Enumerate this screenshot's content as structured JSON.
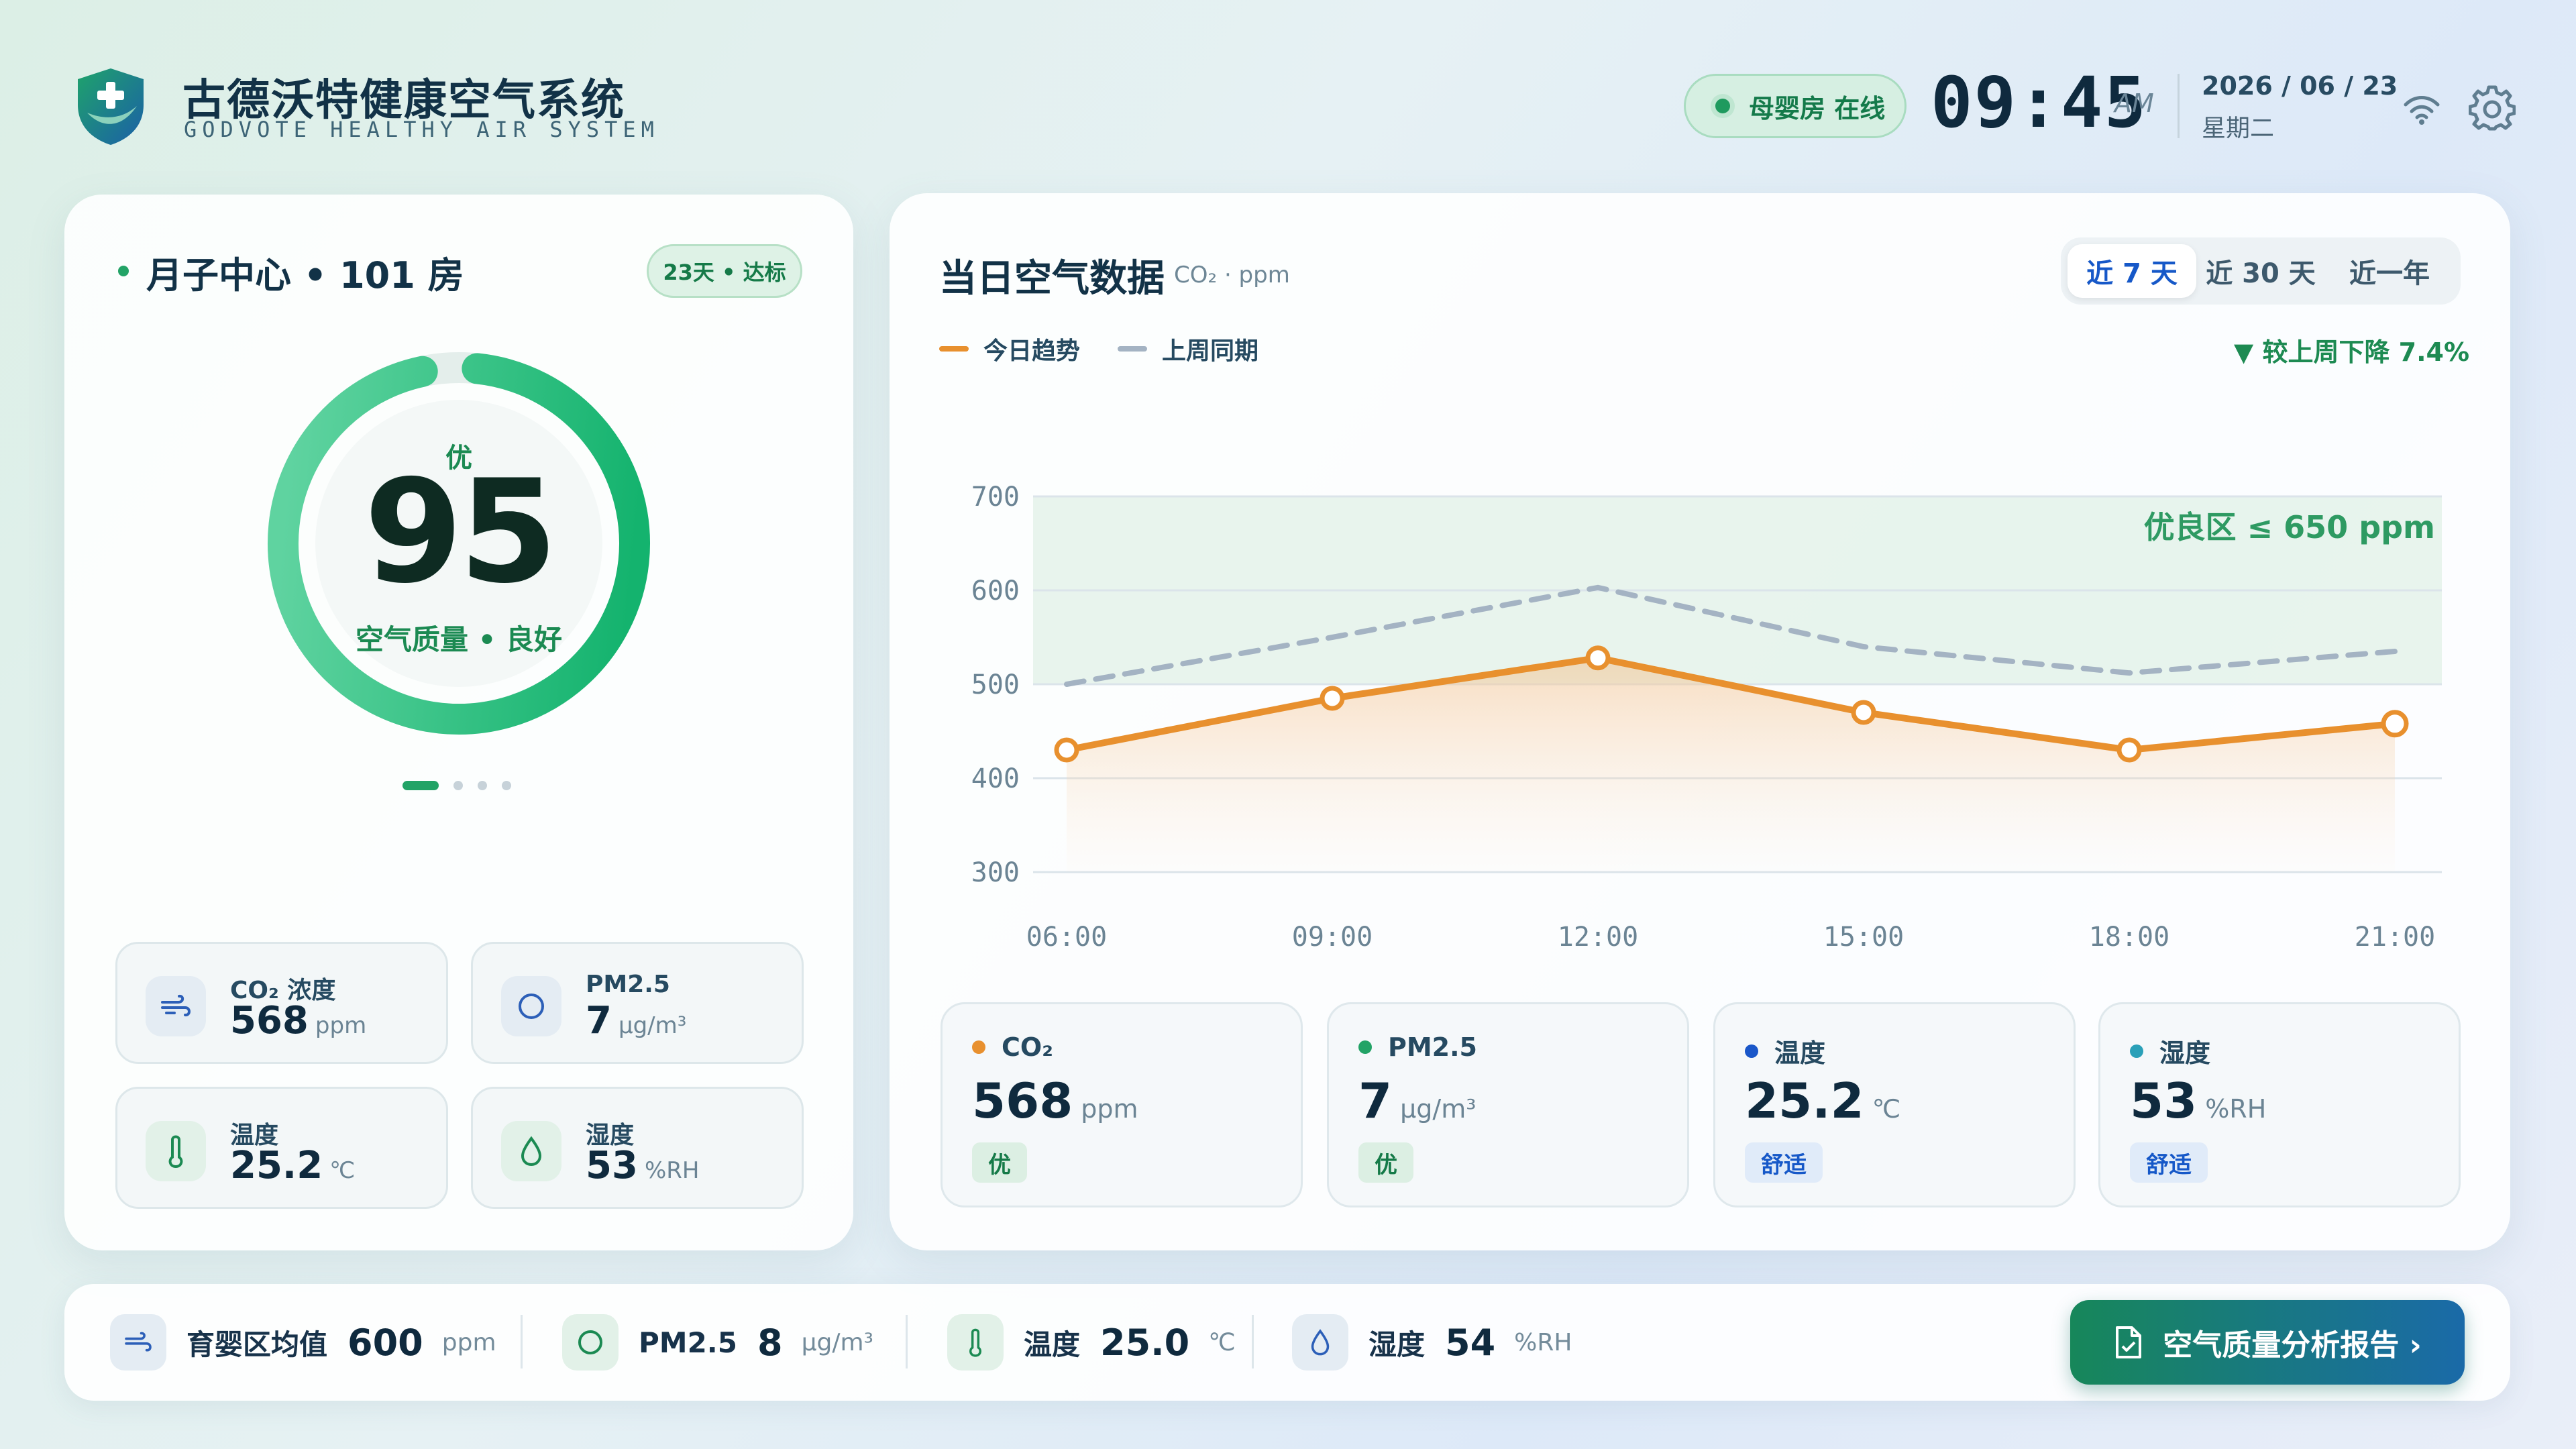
{
  "header": {
    "brand_cn": "古德沃特健康空气系统",
    "brand_en": "GODVOTE HEALTHY AIR SYSTEM",
    "status": "母婴房 在线",
    "time": "09:45",
    "ampm": "AM",
    "date": "2026 / 06 / 23",
    "weekday": "星期二",
    "icons": [
      "shield-plus-logo",
      "wifi-icon",
      "gear-icon"
    ]
  },
  "room": {
    "title": "月子中心 • 101 房",
    "days_badge": "23天 • 达标",
    "grade": "优",
    "score": "95",
    "score_fraction": 0.95,
    "quality_text": "空气质量 • 良好",
    "pager": {
      "count": 4,
      "active": 0
    },
    "metrics": [
      {
        "icon": "wind-icon",
        "label": "CO₂ 浓度",
        "value": "568",
        "unit": "ppm"
      },
      {
        "icon": "circle-icon",
        "label": "PM2.5",
        "value": "7",
        "unit": "μg/m³"
      },
      {
        "icon": "thermometer-icon",
        "label": "温度",
        "value": "25.2",
        "unit": "℃"
      },
      {
        "icon": "droplet-icon",
        "label": "湿度",
        "value": "53",
        "unit": "%RH"
      }
    ]
  },
  "panel": {
    "title": "当日空气数据",
    "subtitle": "CO₂ · ppm",
    "ranges": [
      "近 7 天",
      "近 30 天",
      "近一年"
    ],
    "active_range": 0,
    "legend": [
      "今日趋势",
      "上周同期"
    ],
    "trend": "▼ 较上周下降 7.4%",
    "zone_label": "优良区 ≤ 650 ppm"
  },
  "chart_data": {
    "type": "line",
    "categories": [
      "06:00",
      "09:00",
      "12:00",
      "15:00",
      "18:00",
      "21:00"
    ],
    "series": [
      {
        "name": "今日趋势",
        "values": [
          430,
          485,
          528,
          470,
          430,
          458
        ],
        "color": "#e8902e",
        "style": "solid"
      },
      {
        "name": "上周同期",
        "values": [
          500,
          550,
          603,
          540,
          512,
          535
        ],
        "color": "#a4b3c3",
        "style": "dashed"
      }
    ],
    "yticks": [
      300,
      400,
      500,
      600,
      700
    ],
    "ylim": [
      300,
      700
    ],
    "band": [
      500,
      700
    ],
    "grid": true
  },
  "stats": [
    {
      "label": "CO₂",
      "value": "568",
      "unit": "ppm",
      "tag": "优",
      "dot": "#e8902e",
      "tag_bg": "#dcefe3",
      "tag_fg": "#157a48"
    },
    {
      "label": "PM2.5",
      "value": "7",
      "unit": "μg/m³",
      "tag": "优",
      "dot": "#22a366",
      "tag_bg": "#dcefe3",
      "tag_fg": "#157a48"
    },
    {
      "label": "温度",
      "value": "25.2",
      "unit": "℃",
      "tag": "舒适",
      "dot": "#1a57c9",
      "tag_bg": "#e0ebf9",
      "tag_fg": "#1658c8"
    },
    {
      "label": "湿度",
      "value": "53",
      "unit": "%RH",
      "tag": "舒适",
      "dot": "#2aa0b8",
      "tag_bg": "#e0ebf9",
      "tag_fg": "#1658c8"
    }
  ],
  "bottom": {
    "items": [
      {
        "icon": "wind-icon",
        "label": "育婴区均值",
        "value": "600",
        "unit": "ppm"
      },
      {
        "icon": "circle-icon",
        "label": "PM2.5",
        "value": "8",
        "unit": "μg/m³"
      },
      {
        "icon": "thermometer-icon",
        "label": "温度",
        "value": "25.0",
        "unit": "℃"
      },
      {
        "icon": "droplet-icon",
        "label": "湿度",
        "value": "54",
        "unit": "%RH"
      }
    ],
    "report_button": "空气质量分析报告 ›"
  }
}
